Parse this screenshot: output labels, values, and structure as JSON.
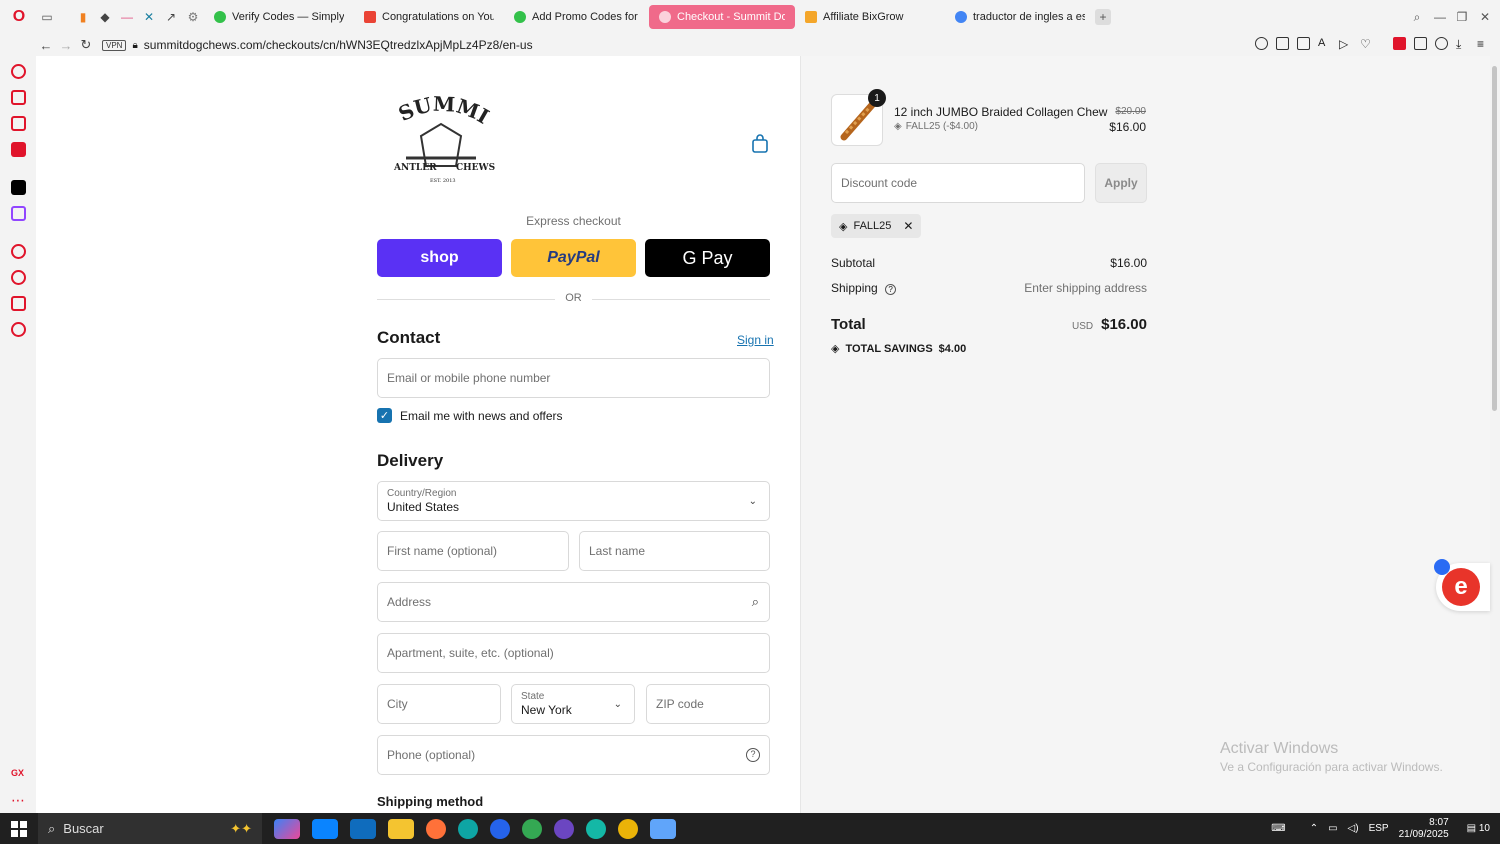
{
  "browser": {
    "tabs": [
      {
        "label": "Verify Codes — SimplyCo",
        "color": "#33c14a"
      },
      {
        "label": "Congratulations on Your N",
        "color": "#ea4335"
      },
      {
        "label": "Add Promo Codes for Su",
        "color": "#33c14a"
      },
      {
        "label": "Checkout - Summit Dog C",
        "color": "#ffffff",
        "active": true
      },
      {
        "label": "Affiliate BixGrow",
        "color": "#f4a62a"
      },
      {
        "label": "traductor de ingles a espa",
        "color": "#4285f4"
      }
    ],
    "vpn_label": "VPN",
    "url": "summitdogchews.com/checkouts/cn/hWN3EQtredzlxApjMpLz4Pz8/en-us"
  },
  "checkout": {
    "logo_alt": "SUMMIT ANTLER CHEWS EST. 2013",
    "express_label": "Express checkout",
    "shop_label": "shop",
    "paypal_label": "PayPal",
    "gpay_label": "G Pay",
    "or_label": "OR",
    "contact_heading": "Contact",
    "sign_in": "Sign in",
    "email_placeholder": "Email or mobile phone number",
    "news_label": "Email me with news and offers",
    "delivery_heading": "Delivery",
    "country_label": "Country/Region",
    "country_value": "United States",
    "first_name": "First name (optional)",
    "last_name": "Last name",
    "address": "Address",
    "apartment": "Apartment, suite, etc. (optional)",
    "city": "City",
    "state_label": "State",
    "state_value": "New York",
    "zip": "ZIP code",
    "phone": "Phone (optional)",
    "shipping_heading": "Shipping method"
  },
  "summary": {
    "quantity": "1",
    "product_name": "12 inch JUMBO Braided Collagen Chew",
    "product_discount": "FALL25 (-$4.00)",
    "price_old": "$20.00",
    "price_new": "$16.00",
    "discount_placeholder": "Discount code",
    "apply_label": "Apply",
    "applied_code": "FALL25",
    "subtotal_label": "Subtotal",
    "subtotal_value": "$16.00",
    "shipping_label": "Shipping",
    "shipping_value": "Enter shipping address",
    "total_label": "Total",
    "currency": "USD",
    "total_value": "$16.00",
    "savings_label": "TOTAL SAVINGS",
    "savings_value": "$4.00"
  },
  "windows": {
    "activate_title": "Activar Windows",
    "activate_sub": "Ve a Configuración para activar Windows.",
    "search_label": "Buscar",
    "lang": "ESP",
    "time": "8:07",
    "date": "21/09/2025",
    "notif_count": "10"
  },
  "colors": {
    "shop": "#5a31f4",
    "paypal": "#ffc439",
    "accent_link": "#1773b0",
    "active_tab": "#f06a8a"
  }
}
